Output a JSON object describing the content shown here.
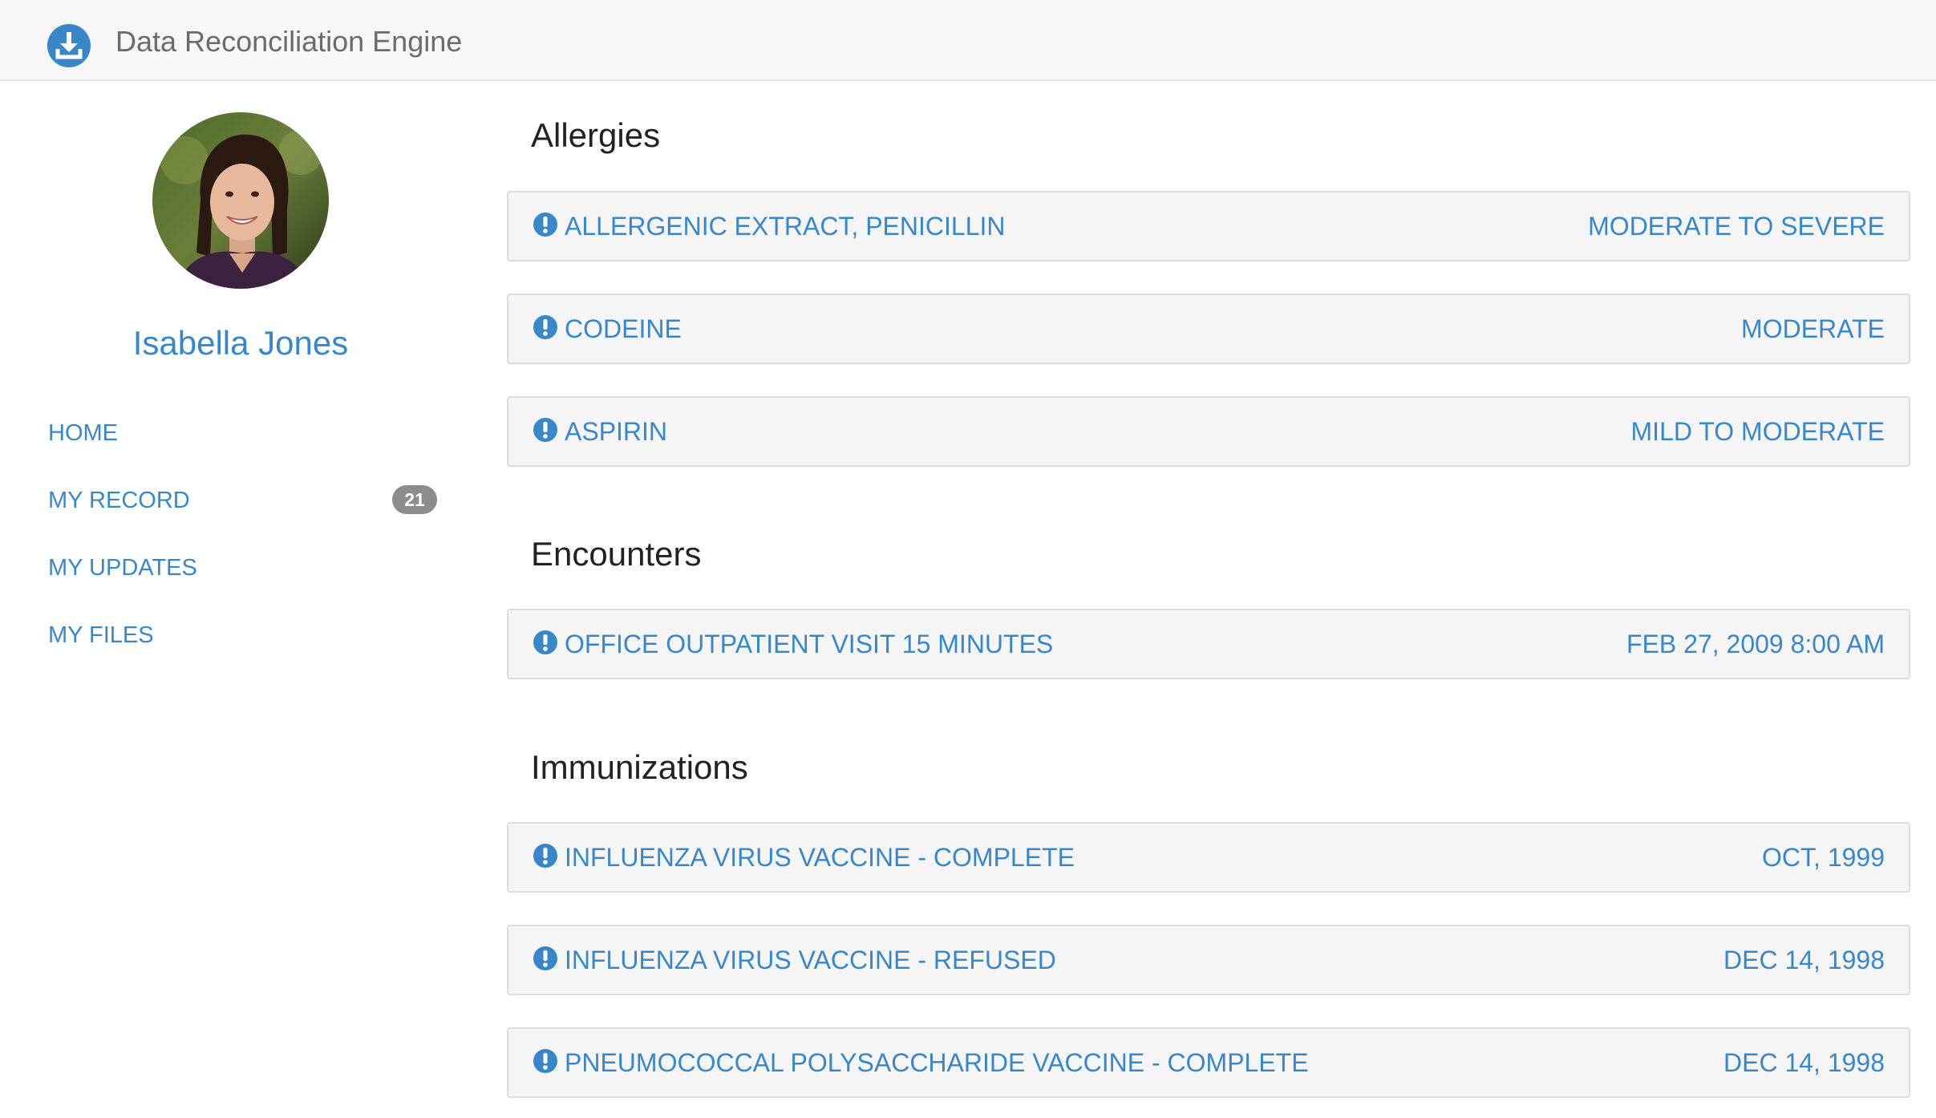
{
  "app": {
    "title": "Data Reconciliation Engine",
    "logo_icon": "download-icon",
    "accent_color": "#3a87c8"
  },
  "user": {
    "name": "Isabella Jones",
    "avatar_icon": "user-avatar"
  },
  "nav": {
    "items": [
      {
        "label": "HOME"
      },
      {
        "label": "MY RECORD",
        "badge": "21"
      },
      {
        "label": "MY UPDATES"
      },
      {
        "label": "MY FILES"
      }
    ]
  },
  "sections": {
    "allergies": {
      "title": "Allergies",
      "items": [
        {
          "label": "ALLERGENIC EXTRACT, PENICILLIN",
          "value": "MODERATE TO SEVERE",
          "icon": "exclamation-circle-icon"
        },
        {
          "label": "CODEINE",
          "value": "MODERATE",
          "icon": "exclamation-circle-icon"
        },
        {
          "label": "ASPIRIN",
          "value": "MILD TO MODERATE",
          "icon": "exclamation-circle-icon"
        }
      ]
    },
    "encounters": {
      "title": "Encounters",
      "items": [
        {
          "label": "OFFICE OUTPATIENT VISIT 15 MINUTES",
          "value": "FEB 27, 2009 8:00 AM",
          "icon": "exclamation-circle-icon"
        }
      ]
    },
    "immunizations": {
      "title": "Immunizations",
      "items": [
        {
          "label": "INFLUENZA VIRUS VACCINE - COMPLETE",
          "value": "OCT, 1999",
          "icon": "exclamation-circle-icon"
        },
        {
          "label": "INFLUENZA VIRUS VACCINE - REFUSED",
          "value": "DEC 14, 1998",
          "icon": "exclamation-circle-icon"
        },
        {
          "label": "PNEUMOCOCCAL POLYSACCHARIDE VACCINE - COMPLETE",
          "value": "DEC 14, 1998",
          "icon": "exclamation-circle-icon"
        }
      ]
    }
  }
}
